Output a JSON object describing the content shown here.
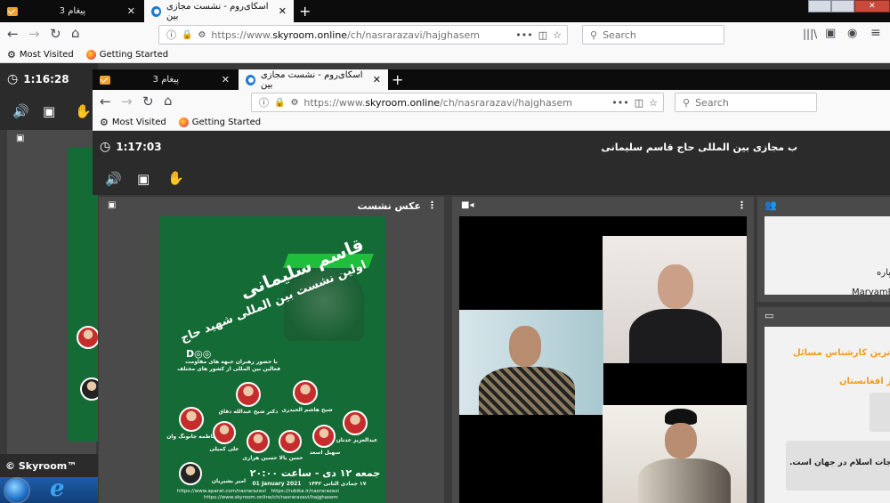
{
  "back_window": {
    "tabs": [
      {
        "label": "3 پیغام"
      },
      {
        "label": "اسکای‌روم - نشست مجازی بین"
      }
    ],
    "url": {
      "prefix": "https://www.",
      "domain": "skyroom.online",
      "path": "/ch/nasrarazavi/hajghasem"
    },
    "search_placeholder": "Search",
    "bookmarks": [
      "Most Visited",
      "Getting Started"
    ],
    "timer": "1:16:28",
    "footer_brand": "© Skyroom™"
  },
  "front_window": {
    "tabs": [
      {
        "label": "3 پیغام"
      },
      {
        "label": "اسکای‌روم - نشست مجازی بین"
      }
    ],
    "url": {
      "prefix": "https://www.",
      "domain": "skyroom.online",
      "path": "/ch/nasrarazavi/hajghasem"
    },
    "search_placeholder": "Search",
    "bookmarks": [
      "Most Visited",
      "Getting Started"
    ],
    "timer": "1:17:03",
    "room_title": "ب مجازی بین المللی حاج قاسم سلیمانی",
    "panels": {
      "photo_title": "عکس نشست"
    },
    "users_text": [
      "پاره",
      "MaryamRa"
    ],
    "chat": {
      "line1": "آزاترین کارشناس مسائل",
      "line2": "از افغانستان",
      "line3": "زله نجات اسلام در جهان است."
    }
  },
  "poster": {
    "title_line1": "قاسم سلیمانی",
    "title_line2": "اولین نشست بین المللی شهید حاج",
    "subtitle": "با حضور رهبران جبهه های مقاومت",
    "subtitle2": "فعالین بین المللی از کشور های مختلف",
    "speakers": [
      "شیخ هاشم الحیدری",
      "دکتر شیخ عبدالله دقاق",
      "فاطمه جانونگ وان",
      "علی کمیلی",
      "حسین هزاری",
      "حسن یالا",
      "سهیل اسعد",
      "عبدالعزیز عدنان",
      "امیر بشیریان"
    ],
    "date_line": "جمعه ۱۲ دی - ساعت ۲۰:۰۰",
    "date_en": "01 January 2021",
    "date_hijri": "۱۷ جمادی الثانی ۱۴۴۲",
    "links": [
      "https://www.aparat.com/nasrarazavi",
      "https://rubika.ir/nasrarazavi",
      "https://www.skyroom.online/ch/nasrarazavi/hajghasem"
    ]
  },
  "colors": {
    "accent": "#f29c1a",
    "green": "#146b35",
    "app_bg": "#2b2b2b"
  }
}
